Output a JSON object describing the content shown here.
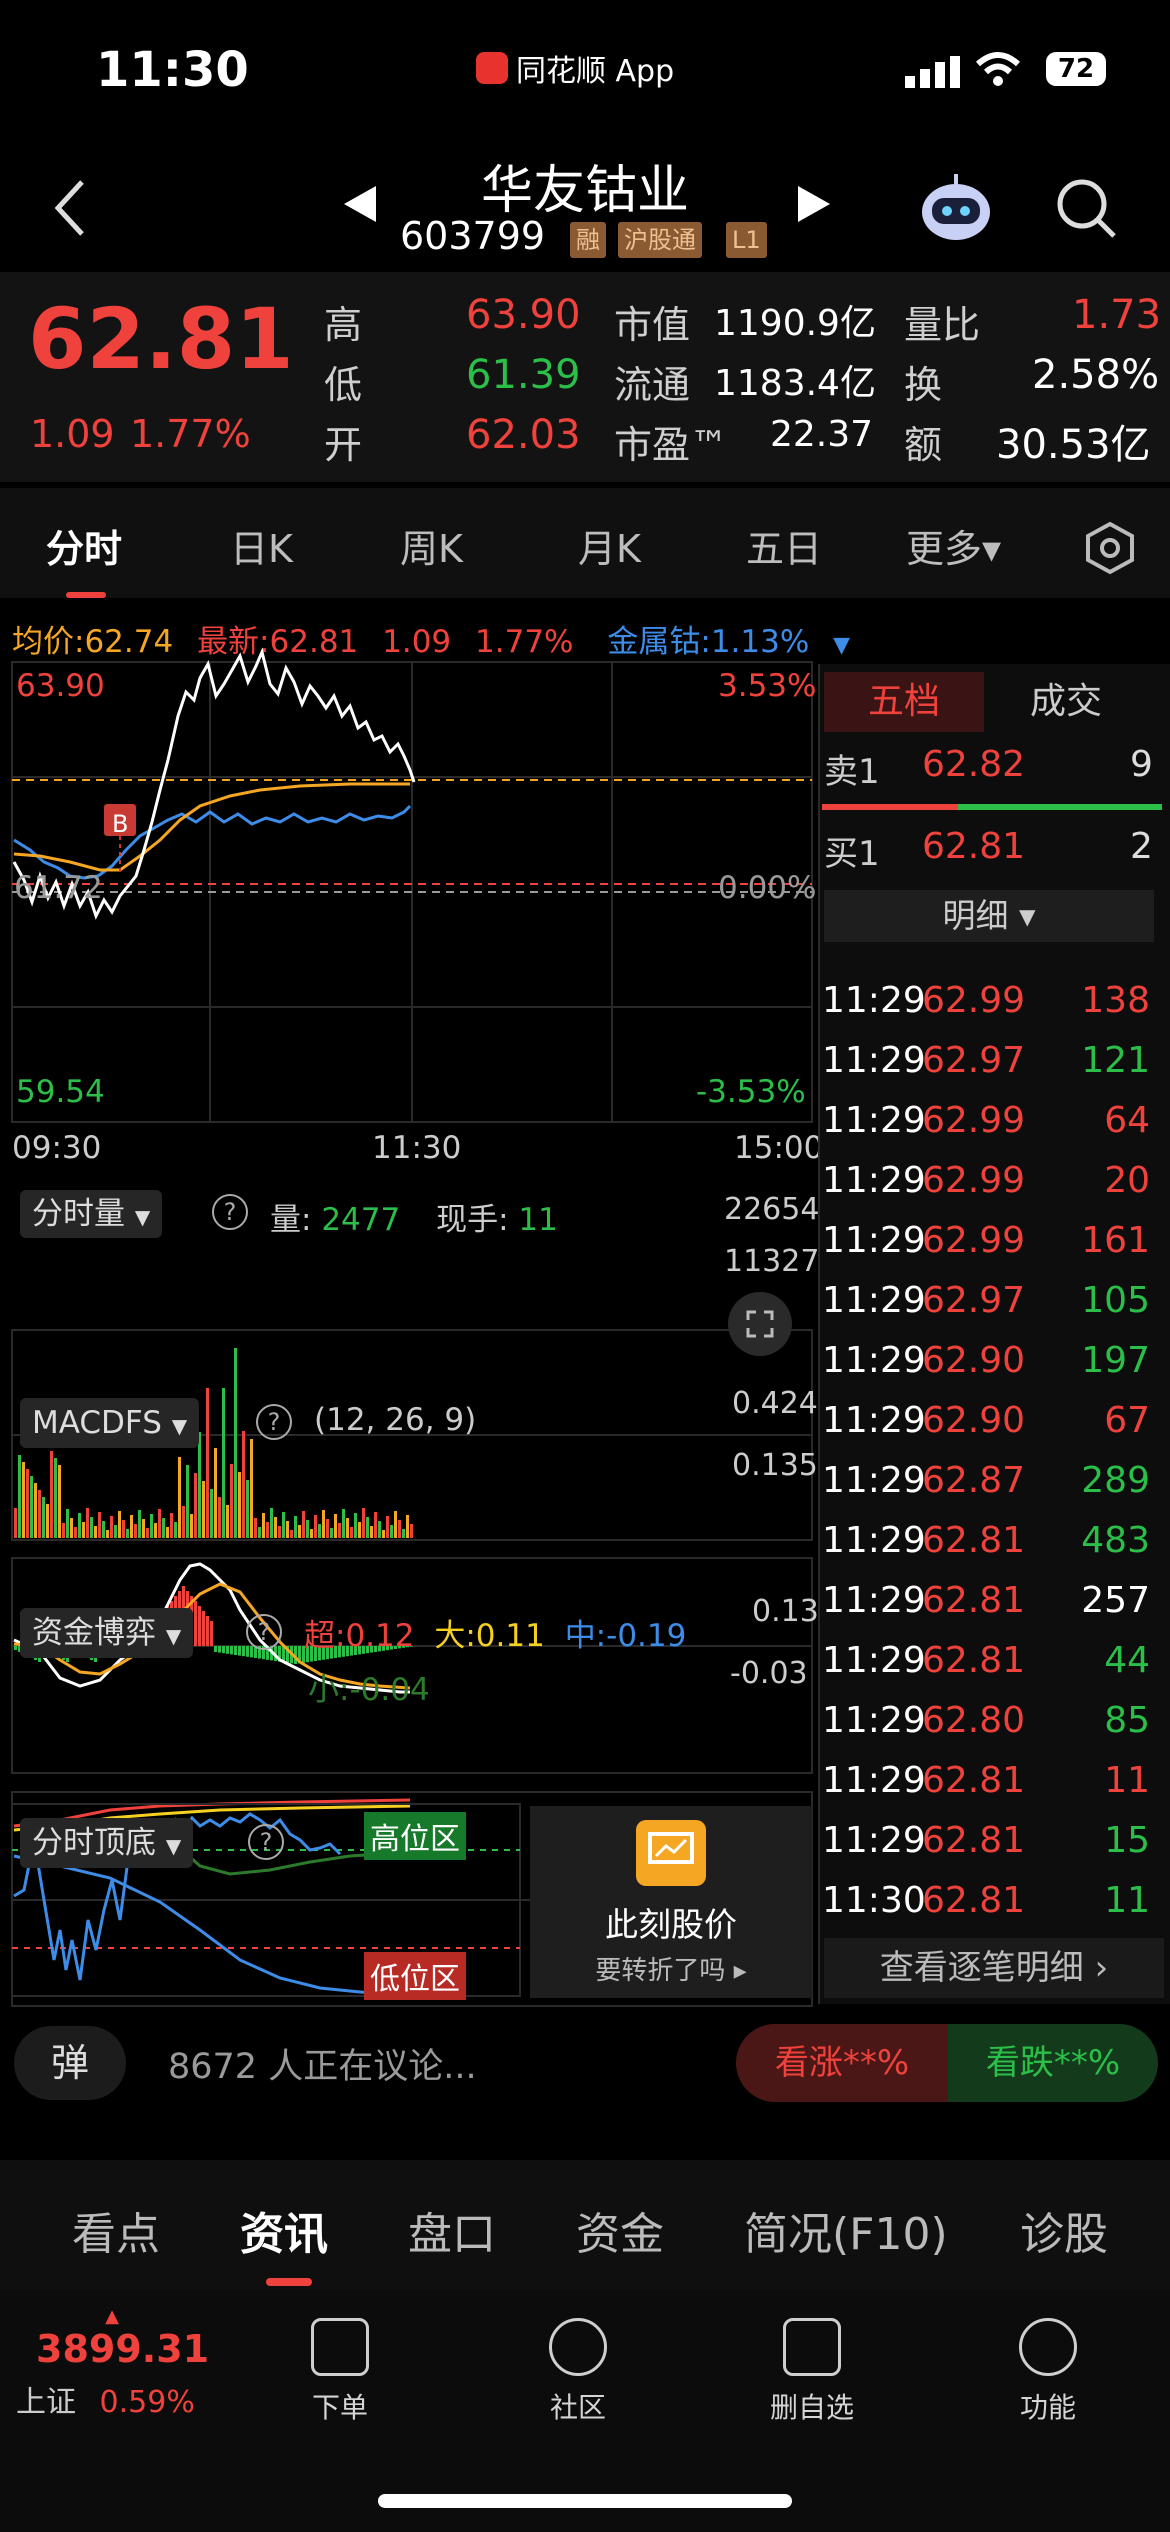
{
  "status_bar": {
    "time": "11:30",
    "app_name": "同花顺 App",
    "battery": "72"
  },
  "header": {
    "stock_name": "华友钴业",
    "stock_code": "603799",
    "tags": [
      "融",
      "沪股通",
      "L1"
    ]
  },
  "quote": {
    "price": "62.81",
    "change": "1.09",
    "change_pct": "1.77%",
    "high_label": "高",
    "high": "63.90",
    "low_label": "低",
    "low": "61.39",
    "open_label": "开",
    "open": "62.03",
    "mcap_label": "市值",
    "mcap": "1190.9亿",
    "float_label": "流通",
    "float": "1183.4亿",
    "pe_label": "市盈™",
    "pe": "22.37",
    "vol_ratio_label": "量比",
    "vol_ratio": "1.73",
    "turnover_label": "换",
    "turnover": "2.58%",
    "amount_label": "额",
    "amount": "30.53亿"
  },
  "chart_tabs": [
    "分时",
    "日K",
    "周K",
    "月K",
    "五日",
    "更多▾"
  ],
  "intraday": {
    "avg_label": "均价:",
    "avg": "62.74",
    "latest_label": "最新:",
    "latest": "62.81",
    "chg": "1.09",
    "chg_pct": "1.77%",
    "sector_label": "金属钴:",
    "sector_pct": "1.13%",
    "y_high": "63.90",
    "y_low": "59.54",
    "y_mid": "61.72",
    "pct_high": "3.53%",
    "pct_mid": "0.00%",
    "pct_low": "-3.53%",
    "t_start": "09:30",
    "t_mid": "11:30",
    "t_end": "15:00",
    "marker": "B"
  },
  "volume_panel": {
    "title": "分时量",
    "vol_label": "量:",
    "vol": "2477",
    "hand_label": "现手:",
    "hand": "11",
    "y_top": "22654",
    "y_mid": "11327"
  },
  "macd_panel": {
    "title": "MACDFS",
    "params": "(12, 26, 9)",
    "y_top": "0.424",
    "y_mid": "0.135"
  },
  "fund_panel": {
    "title": "资金博弈",
    "super_label": "超:",
    "super": "0.12",
    "big_label": "大:",
    "big": "0.11",
    "mid_label": "中:",
    "mid": "-0.19",
    "small_label": "小:",
    "small": "-0.04",
    "y_top": "0.13",
    "y_mid": "-0.03"
  },
  "top_bottom_panel": {
    "title": "分时顶底",
    "high_zone": "高位区",
    "low_zone": "低位区"
  },
  "promo": {
    "title": "此刻股价",
    "subtitle": "要转折了吗 ▸"
  },
  "order_book": {
    "tab_five": "五档",
    "tab_trades": "成交",
    "sell1_label": "卖1",
    "sell1_price": "62.82",
    "sell1_vol": "9",
    "buy1_label": "买1",
    "buy1_price": "62.81",
    "buy1_vol": "2",
    "detail_label": "明细 ▾",
    "trades": [
      {
        "t": "11:29",
        "p": "62.99",
        "v": "138",
        "c": "red"
      },
      {
        "t": "11:29",
        "p": "62.97",
        "v": "121",
        "c": "green"
      },
      {
        "t": "11:29",
        "p": "62.99",
        "v": "64",
        "c": "red"
      },
      {
        "t": "11:29",
        "p": "62.99",
        "v": "20",
        "c": "red"
      },
      {
        "t": "11:29",
        "p": "62.99",
        "v": "161",
        "c": "red"
      },
      {
        "t": "11:29",
        "p": "62.97",
        "v": "105",
        "c": "green"
      },
      {
        "t": "11:29",
        "p": "62.90",
        "v": "197",
        "c": "green"
      },
      {
        "t": "11:29",
        "p": "62.90",
        "v": "67",
        "c": "red"
      },
      {
        "t": "11:29",
        "p": "62.87",
        "v": "289",
        "c": "green"
      },
      {
        "t": "11:29",
        "p": "62.81",
        "v": "483",
        "c": "green"
      },
      {
        "t": "11:29",
        "p": "62.81",
        "v": "257",
        "c": "white"
      },
      {
        "t": "11:29",
        "p": "62.81",
        "v": "44",
        "c": "green"
      },
      {
        "t": "11:29",
        "p": "62.80",
        "v": "85",
        "c": "green"
      },
      {
        "t": "11:29",
        "p": "62.81",
        "v": "11",
        "c": "red"
      },
      {
        "t": "11:29",
        "p": "62.81",
        "v": "15",
        "c": "green"
      },
      {
        "t": "11:30",
        "p": "62.81",
        "v": "11",
        "c": "green"
      }
    ],
    "view_all": "查看逐笔明细 ›"
  },
  "discuss": {
    "placeholder": "8672 人正在议论...",
    "bull": "看涨**%",
    "bear": "看跌**%",
    "danmu": "弹"
  },
  "bottom_tabs": [
    "看点",
    "资讯",
    "盘口",
    "资金",
    "简况(F10)",
    "诊股"
  ],
  "bottom_nav": {
    "index_value": "3899.31",
    "index_name": "上证",
    "index_pct": "0.59%",
    "items": [
      "下单",
      "社区",
      "删自选",
      "功能"
    ]
  },
  "colors": {
    "up": "#f0423c",
    "down": "#2bbf4a",
    "avg": "#f5a623",
    "sector": "#3d8de8"
  }
}
